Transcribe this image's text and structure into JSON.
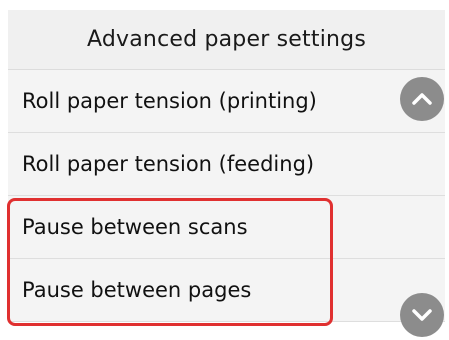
{
  "header": {
    "title": "Advanced paper settings"
  },
  "menu": {
    "items": [
      {
        "label": "Roll paper tension (printing)"
      },
      {
        "label": "Roll paper tension (feeding)"
      },
      {
        "label": "Pause between scans"
      },
      {
        "label": "Pause between pages"
      }
    ]
  },
  "highlight": {
    "color": "#e03030"
  },
  "scroll": {
    "up_icon": "chevron-up-icon",
    "down_icon": "chevron-down-icon",
    "button_color": "#8c8c8c"
  }
}
